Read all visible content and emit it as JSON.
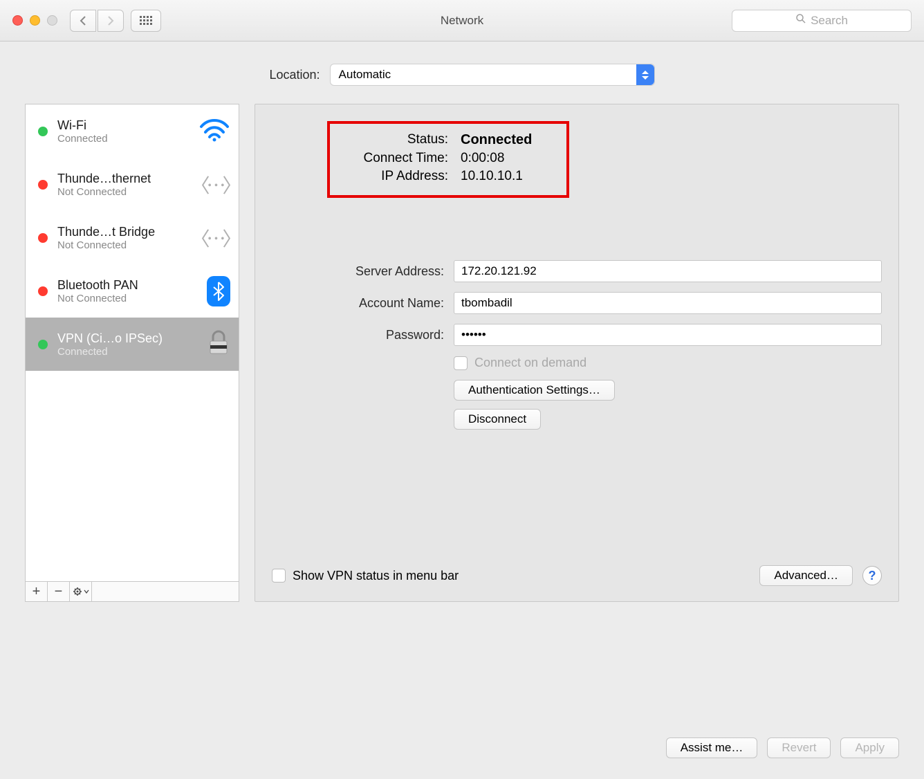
{
  "window": {
    "title": "Network"
  },
  "search": {
    "placeholder": "Search"
  },
  "location": {
    "label": "Location:",
    "value": "Automatic"
  },
  "sidebar": {
    "items": [
      {
        "name": "Wi-Fi",
        "status": "Connected",
        "dot": "green",
        "icon": "wifi"
      },
      {
        "name": "Thunde…thernet",
        "status": "Not Connected",
        "dot": "red",
        "icon": "eth"
      },
      {
        "name": "Thunde…t Bridge",
        "status": "Not Connected",
        "dot": "red",
        "icon": "eth"
      },
      {
        "name": "Bluetooth PAN",
        "status": "Not Connected",
        "dot": "red",
        "icon": "bt"
      },
      {
        "name": "VPN (Ci…o IPSec)",
        "status": "Connected",
        "dot": "green",
        "icon": "lock",
        "selected": true
      }
    ],
    "footer": {
      "plus": "+",
      "minus": "−",
      "gear": "⚙︎▾"
    }
  },
  "status": {
    "status_label": "Status:",
    "status_value": "Connected",
    "time_label": "Connect Time:",
    "time_value": "0:00:08",
    "ip_label": "IP Address:",
    "ip_value": "10.10.10.1"
  },
  "form": {
    "server_label": "Server Address:",
    "server_value": "172.20.121.92",
    "account_label": "Account Name:",
    "account_value": "tbombadil",
    "password_label": "Password:",
    "password_value": "••••••",
    "cod_label": "Connect on demand",
    "auth_btn": "Authentication Settings…",
    "disconnect_btn": "Disconnect"
  },
  "bottom": {
    "show_vpn": "Show VPN status in menu bar",
    "advanced": "Advanced…",
    "help": "?"
  },
  "actions": {
    "assist": "Assist me…",
    "revert": "Revert",
    "apply": "Apply"
  }
}
